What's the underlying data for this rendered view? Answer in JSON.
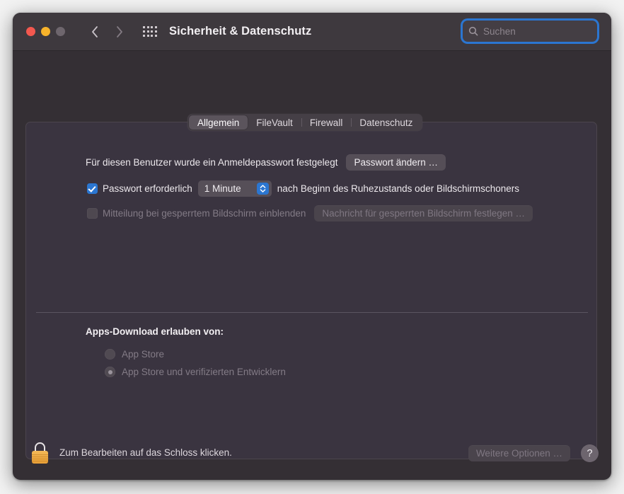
{
  "window": {
    "title": "Sicherheit & Datenschutz",
    "traffic_lights": [
      "close-button",
      "minimize-button",
      "zoom-button"
    ],
    "nav": {
      "back_icon": "chevron-left-icon",
      "forward_icon": "chevron-right-icon",
      "grid_icon": "grid-view-icon"
    },
    "colors": {
      "titlebar": "#3e393e",
      "body": "#342f34",
      "panel": "#3a3440",
      "accent": "#2b76d1",
      "text": "#ece8ec",
      "text_disabled": "#837b86",
      "lock_gold": "#f0ae4a"
    }
  },
  "search": {
    "placeholder": "Suchen",
    "value": "",
    "icon": "search-icon",
    "focused": true
  },
  "tabs": [
    {
      "label": "Allgemein",
      "active": true
    },
    {
      "label": "FileVault",
      "active": false
    },
    {
      "label": "Firewall",
      "active": false
    },
    {
      "label": "Datenschutz",
      "active": false
    }
  ],
  "general": {
    "password_set_label": "Für diesen Benutzer wurde ein Anmeldepasswort festgelegt",
    "change_password_button": "Passwort ändern …",
    "require_password": {
      "checked": true,
      "label": "Passwort erforderlich",
      "delay_value": "1 Minute",
      "suffix_label": "nach Beginn des Ruhezustands oder Bildschirmschoners"
    },
    "lock_message": {
      "checked": false,
      "enabled": false,
      "label": "Mitteilung bei gesperrtem Bildschirm einblenden",
      "button": "Nachricht für gesperrten Bildschirm festlegen …"
    },
    "app_download": {
      "heading": "Apps-Download erlauben von:",
      "enabled": false,
      "options": [
        {
          "label": "App Store",
          "selected": false
        },
        {
          "label": "App Store und verifizierten Entwicklern",
          "selected": true
        }
      ]
    }
  },
  "footer": {
    "lock_icon": "lock-closed-icon",
    "lock_text": "Zum Bearbeiten auf das Schloss klicken.",
    "advanced_button": "Weitere Optionen …",
    "advanced_enabled": false,
    "help_label": "?"
  }
}
